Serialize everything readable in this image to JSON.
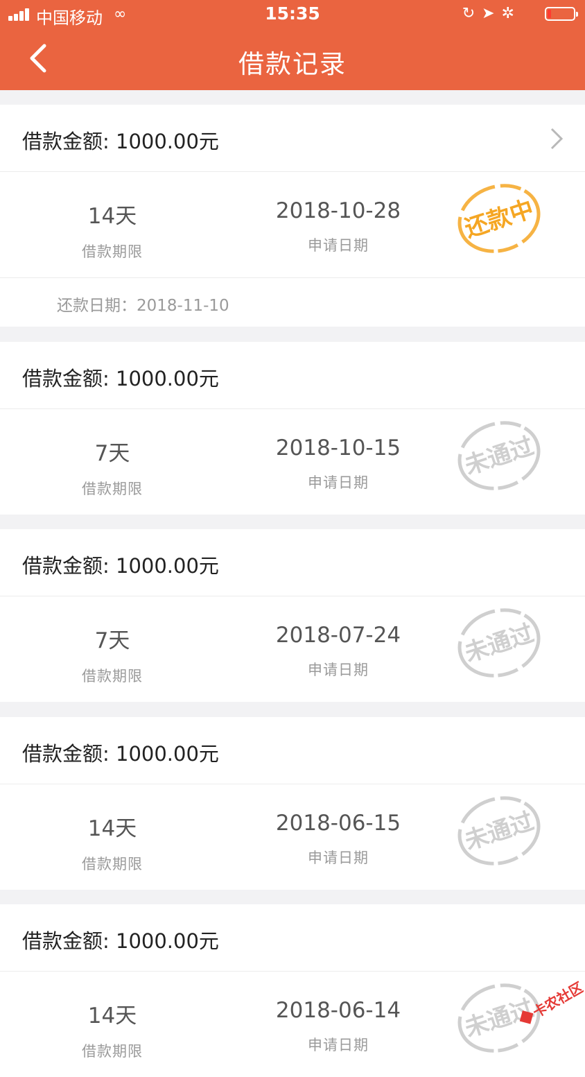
{
  "status_bar": {
    "carrier": "中国移动",
    "time": "15:35"
  },
  "nav": {
    "title": "借款记录",
    "back_icon": "chevron-left-icon"
  },
  "records": [
    {
      "amount": "借款金额: 1000.00元",
      "term": "14天",
      "term_label": "借款期限",
      "apply_date": "2018-10-28",
      "apply_label": "申请日期",
      "status": "还款中",
      "repay": "还款日期：2018-11-10",
      "has_arrow": true
    },
    {
      "amount": "借款金额: 1000.00元",
      "term": "7天",
      "term_label": "借款期限",
      "apply_date": "2018-10-15",
      "apply_label": "申请日期",
      "status": "未通过"
    },
    {
      "amount": "借款金额: 1000.00元",
      "term": "7天",
      "term_label": "借款期限",
      "apply_date": "2018-07-24",
      "apply_label": "申请日期",
      "status": "未通过"
    },
    {
      "amount": "借款金额: 1000.00元",
      "term": "14天",
      "term_label": "借款期限",
      "apply_date": "2018-06-15",
      "apply_label": "申请日期",
      "status": "未通过"
    },
    {
      "amount": "借款金额: 1000.00元",
      "term": "14天",
      "term_label": "借款期限",
      "apply_date": "2018-06-14",
      "apply_label": "申请日期",
      "status": "未通过"
    }
  ],
  "watermark": "卡农社区",
  "colors": {
    "brand": "#ea6440",
    "stamp_active": "#f5a623",
    "stamp_rejected": "#cfcfcf"
  }
}
